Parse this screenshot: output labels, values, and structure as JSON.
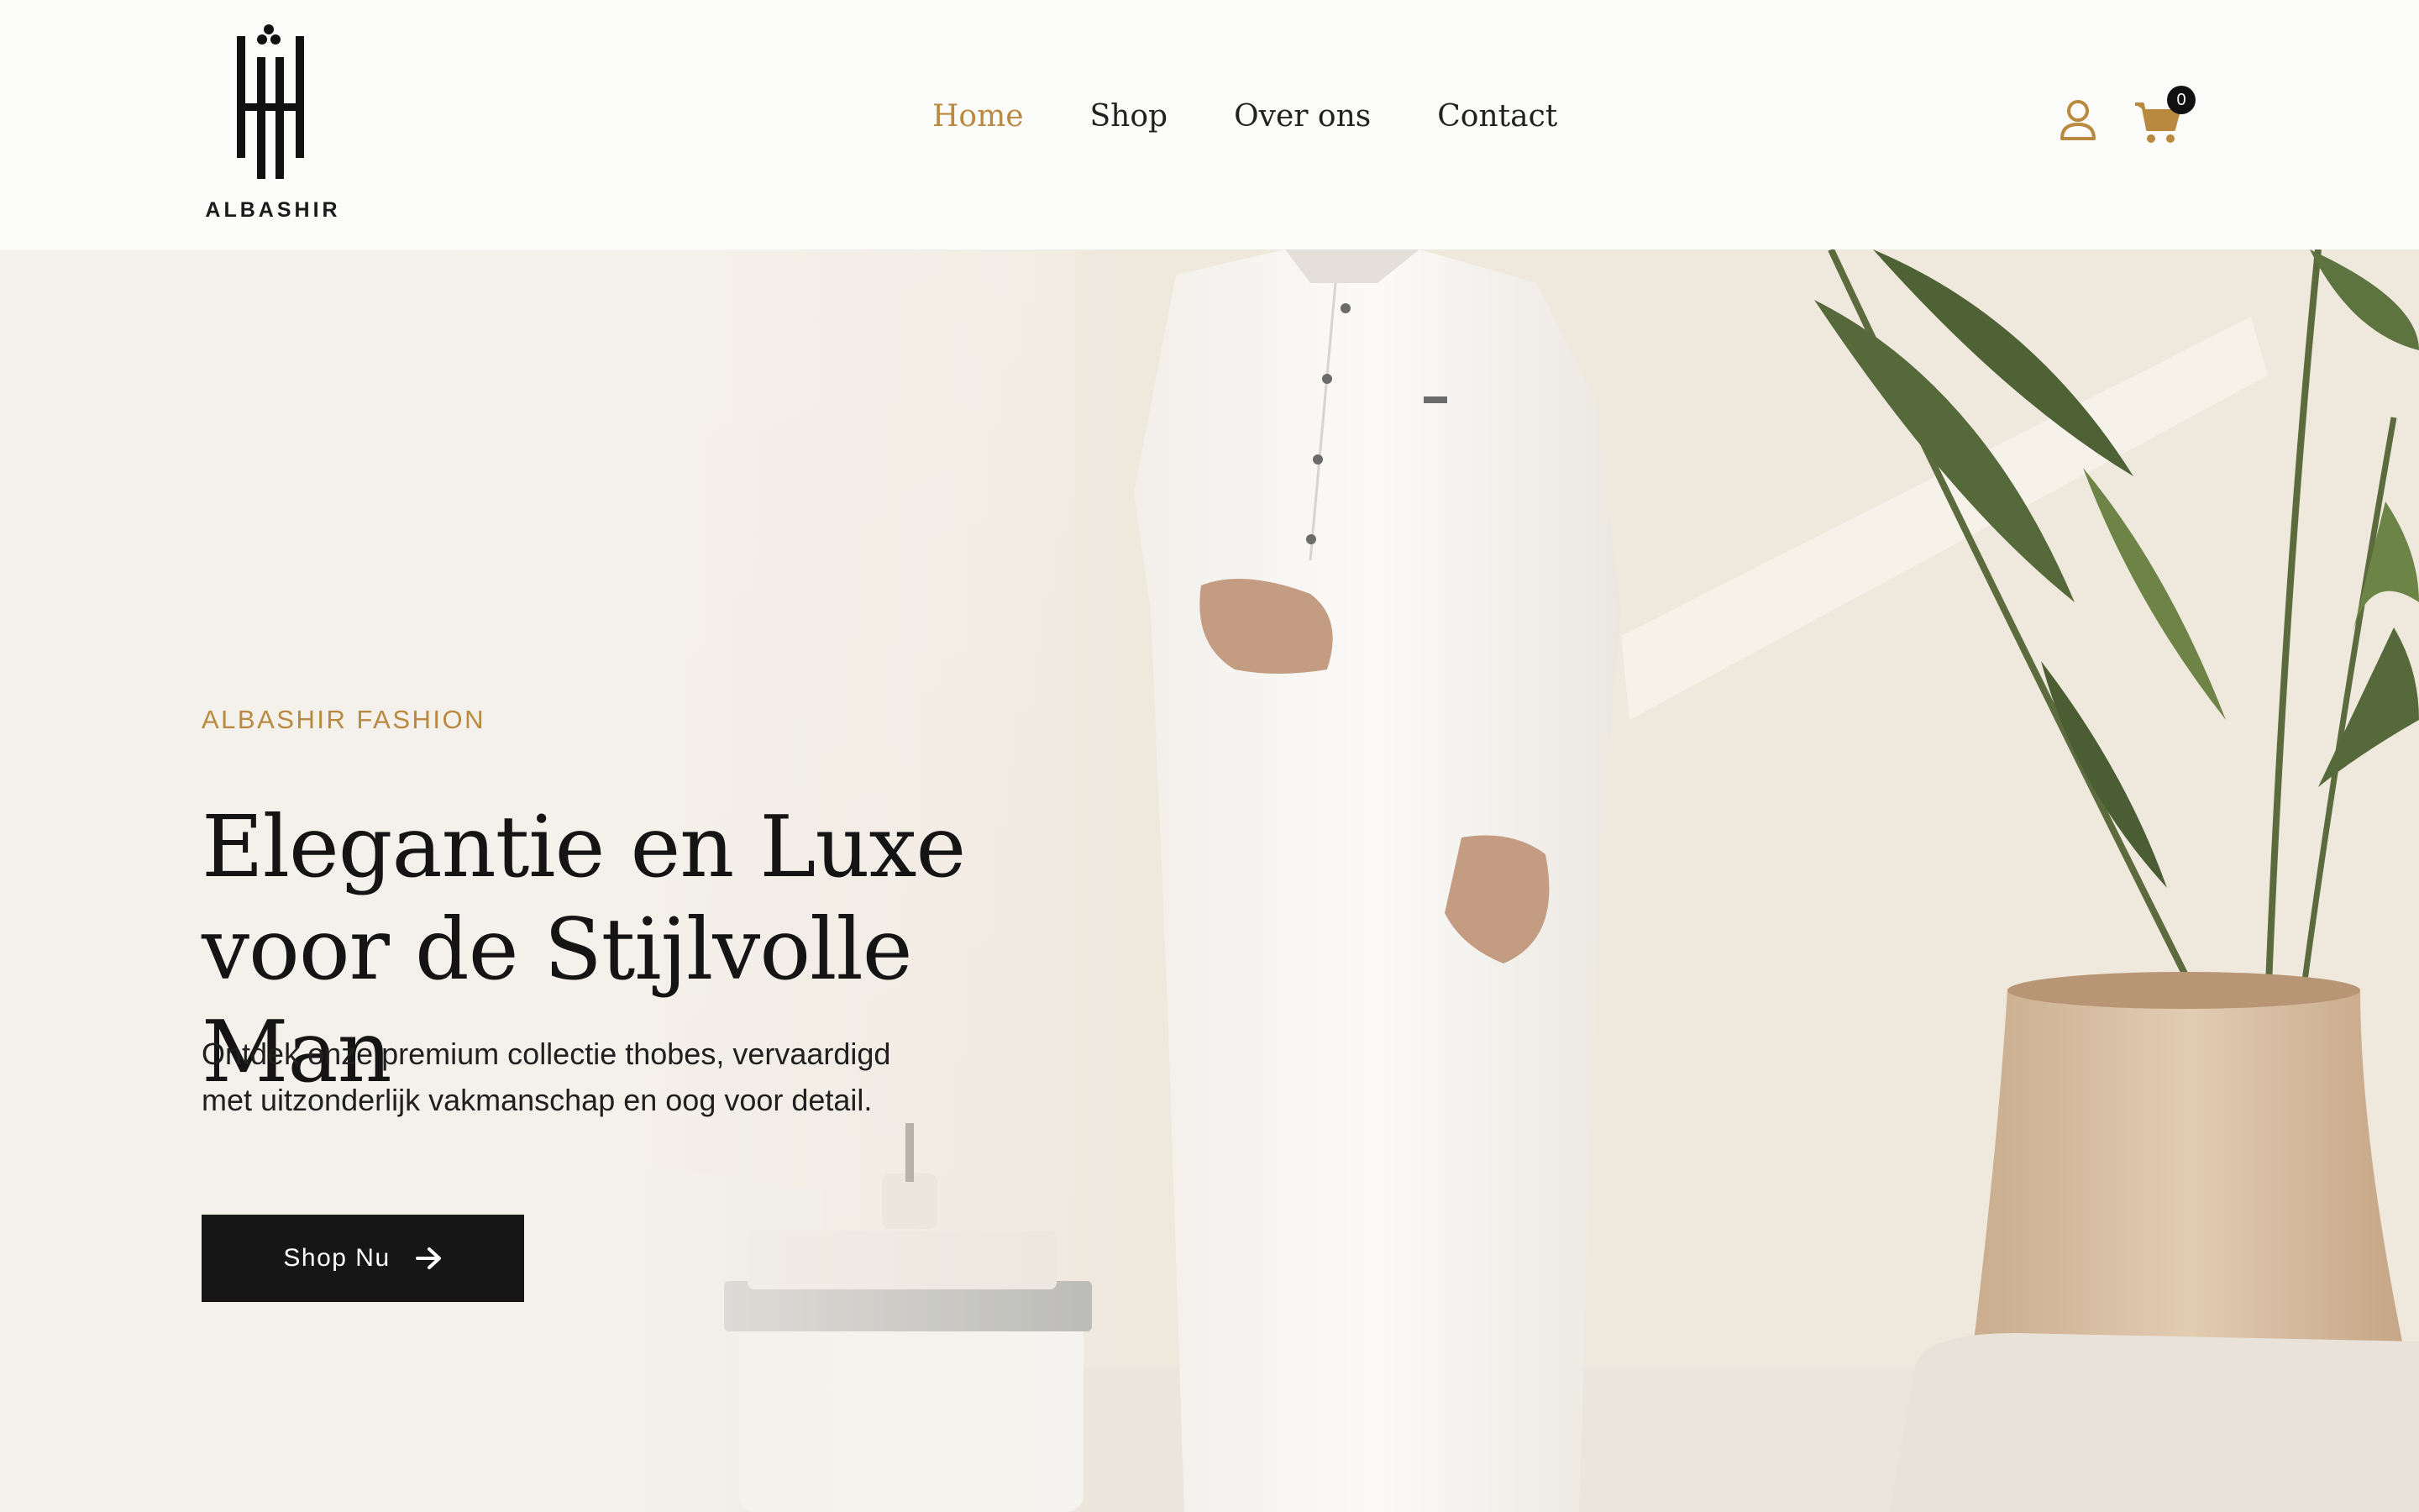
{
  "brand": {
    "name": "ALBASHIR"
  },
  "nav": {
    "items": [
      {
        "label": "Home",
        "active": true
      },
      {
        "label": "Shop",
        "active": false
      },
      {
        "label": "Over ons",
        "active": false
      },
      {
        "label": "Contact",
        "active": false
      }
    ]
  },
  "header_icons": {
    "account_icon": "user-icon",
    "cart_icon": "cart-icon",
    "cart_count": "0"
  },
  "hero": {
    "eyebrow": "ALBASHIR FASHION",
    "headline_line1": "Elegantie en Luxe",
    "headline_line2": "voor de Stijlvolle Man",
    "subtext_line1": "Ontdek onze premium collectie thobes, vervaardigd",
    "subtext_line2": "met uitzonderlijk vakmanschap en oog voor detail.",
    "cta_label": "Shop Nu",
    "cta_icon": "arrow-right-icon"
  },
  "colors": {
    "accent": "#b8893f",
    "text_dark": "#141414",
    "button_bg": "#161616",
    "header_bg": "#fbfbfa"
  }
}
